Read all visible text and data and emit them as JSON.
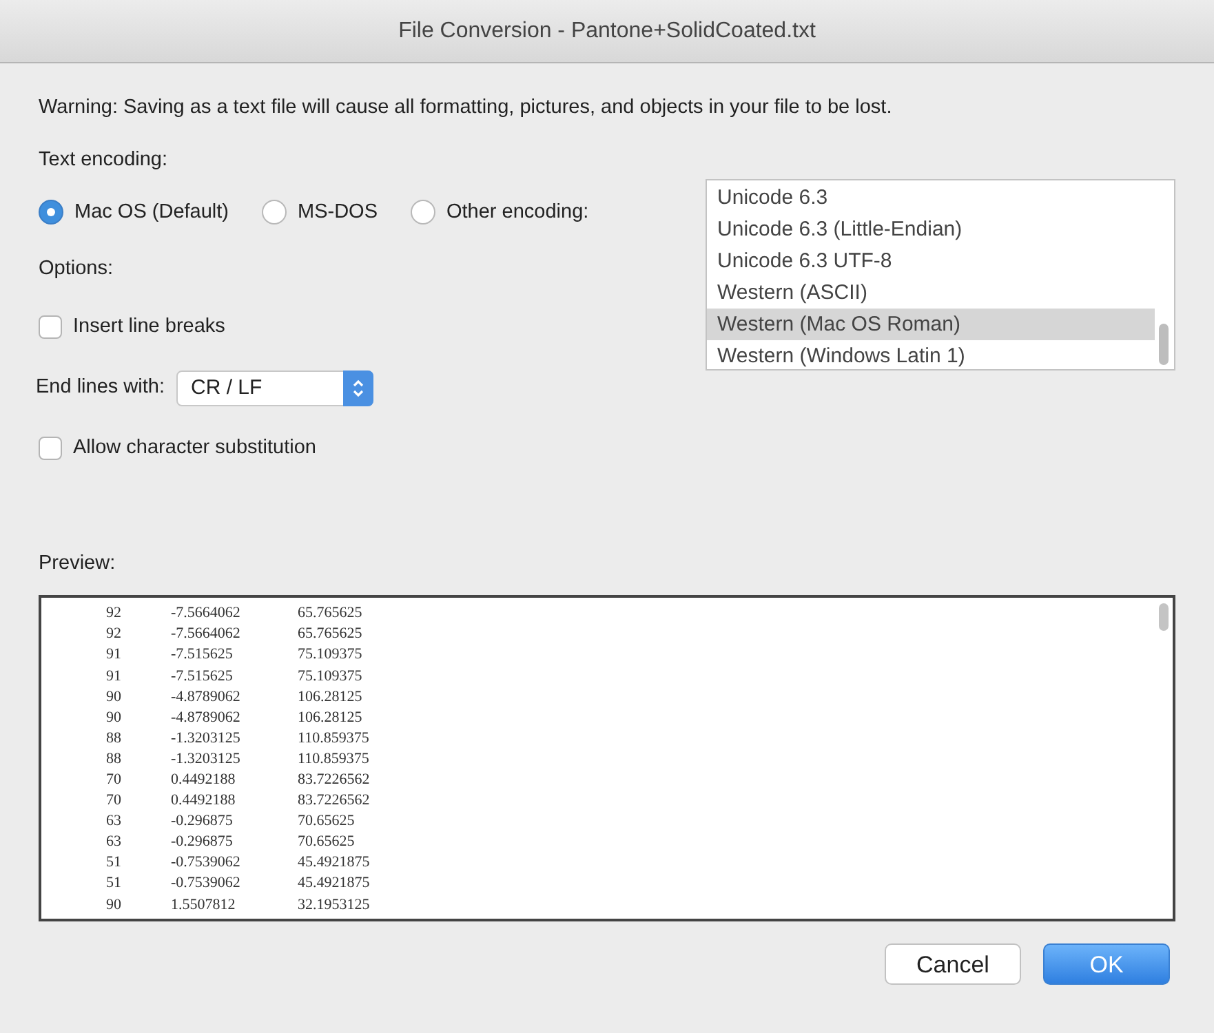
{
  "window": {
    "title": "File Conversion - Pantone+SolidCoated.txt"
  },
  "warning": "Warning: Saving as a text file will cause all formatting, pictures, and objects in your file to be lost.",
  "encoding_label": "Text encoding:",
  "encodings": [
    {
      "label": "Mac OS (Default)",
      "selected": true
    },
    {
      "label": "MS-DOS",
      "selected": false
    },
    {
      "label": "Other encoding:",
      "selected": false
    }
  ],
  "encoding_list": [
    {
      "label": "Unicode 6.3",
      "selected": false
    },
    {
      "label": "Unicode 6.3 (Little-Endian)",
      "selected": false
    },
    {
      "label": "Unicode 6.3 UTF-8",
      "selected": false
    },
    {
      "label": "Western (ASCII)",
      "selected": false
    },
    {
      "label": "Western (Mac OS Roman)",
      "selected": true
    },
    {
      "label": "Western (Windows Latin 1)",
      "selected": false
    }
  ],
  "options_label": "Options:",
  "options": [
    {
      "kind": "checkbox",
      "label": "Insert line breaks",
      "checked": false
    },
    {
      "kind": "select",
      "label": "End lines with:",
      "value": "CR / LF"
    },
    {
      "kind": "checkbox",
      "label": "Allow character substitution",
      "checked": false
    }
  ],
  "preview_label": "Preview:",
  "preview_rows": [
    [
      "92",
      "-7.5664062",
      "65.765625"
    ],
    [
      "92",
      "-7.5664062",
      "65.765625"
    ],
    [
      "91",
      "-7.515625",
      "75.109375"
    ],
    [
      "91",
      "-7.515625",
      "75.109375"
    ],
    [
      "90",
      "-4.8789062",
      "106.28125"
    ],
    [
      "90",
      "-4.8789062",
      "106.28125"
    ],
    [
      "88",
      "-1.3203125",
      "110.859375"
    ],
    [
      "88",
      "-1.3203125",
      "110.859375"
    ],
    [
      "70",
      "0.4492188",
      "83.7226562"
    ],
    [
      "70",
      "0.4492188",
      "83.7226562"
    ],
    [
      "63",
      "-0.296875",
      "70.65625"
    ],
    [
      "63",
      "-0.296875",
      "70.65625"
    ],
    [
      "51",
      "-0.7539062",
      "45.4921875"
    ],
    [
      "51",
      "-0.7539062",
      "45.4921875"
    ],
    [
      "90",
      "1.5507812",
      "32.1953125"
    ]
  ],
  "buttons": [
    {
      "label": "Cancel",
      "kind": "secondary"
    },
    {
      "label": "OK",
      "kind": "default"
    }
  ]
}
